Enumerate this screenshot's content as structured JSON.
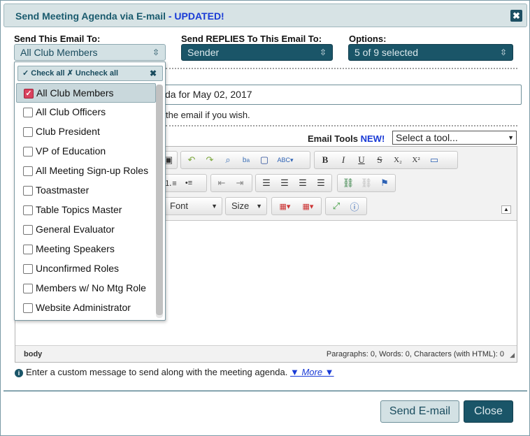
{
  "dialog": {
    "title": "Send Meeting Agenda via E-mail",
    "title_suffix": "- UPDATED!",
    "close_glyph": "✖"
  },
  "send_to": {
    "label": "Send This Email To:",
    "value": "All Club Members"
  },
  "replies_to": {
    "label": "Send REPLIES To This Email To:",
    "value": "Sender"
  },
  "options": {
    "label": "Options:",
    "value": "5 of 9 selected"
  },
  "select_arrow": "⇳",
  "dropdown": {
    "check_all": "✓ Check all",
    "uncheck_all": "✗ Uncheck all",
    "close_glyph": "✖",
    "items": [
      {
        "label": "All Club Members",
        "checked": true
      },
      {
        "label": "All Club Officers",
        "checked": false
      },
      {
        "label": "Club President",
        "checked": false
      },
      {
        "label": "VP of Education",
        "checked": false
      },
      {
        "label": "All Meeting Sign-up Roles",
        "checked": false
      },
      {
        "label": "Toastmaster",
        "checked": false
      },
      {
        "label": "Table Topics Master",
        "checked": false
      },
      {
        "label": "General Evaluator",
        "checked": false
      },
      {
        "label": "Meeting Speakers",
        "checked": false
      },
      {
        "label": "Unconfirmed Roles",
        "checked": false
      },
      {
        "label": "Members w/ No Mtg Role",
        "checked": false
      },
      {
        "label": "Website Administrator",
        "checked": false
      }
    ]
  },
  "subject": {
    "visible_value": "da for May 02, 2017"
  },
  "hint_text": "the email if you wish.",
  "email_tools": {
    "label": "Email Tools",
    "new_badge": "NEW!",
    "placeholder": "Select a tool..."
  },
  "editor": {
    "font_combo": "Font",
    "size_combo": "Size",
    "status_left": "body",
    "status_right": "Paragraphs: 0, Words: 0, Characters (with HTML): 0"
  },
  "info": {
    "icon": "i",
    "text": "Enter a custom message to send along with the meeting agenda.",
    "more_link": "▼ More ▼"
  },
  "footer": {
    "send_label": "Send E-mail",
    "close_label": "Close"
  },
  "colors": {
    "brand_dark": "#1a5568",
    "brand_light": "#d3e1e4",
    "accent_blue": "#1a3bd6",
    "check_red": "#d9425e"
  }
}
